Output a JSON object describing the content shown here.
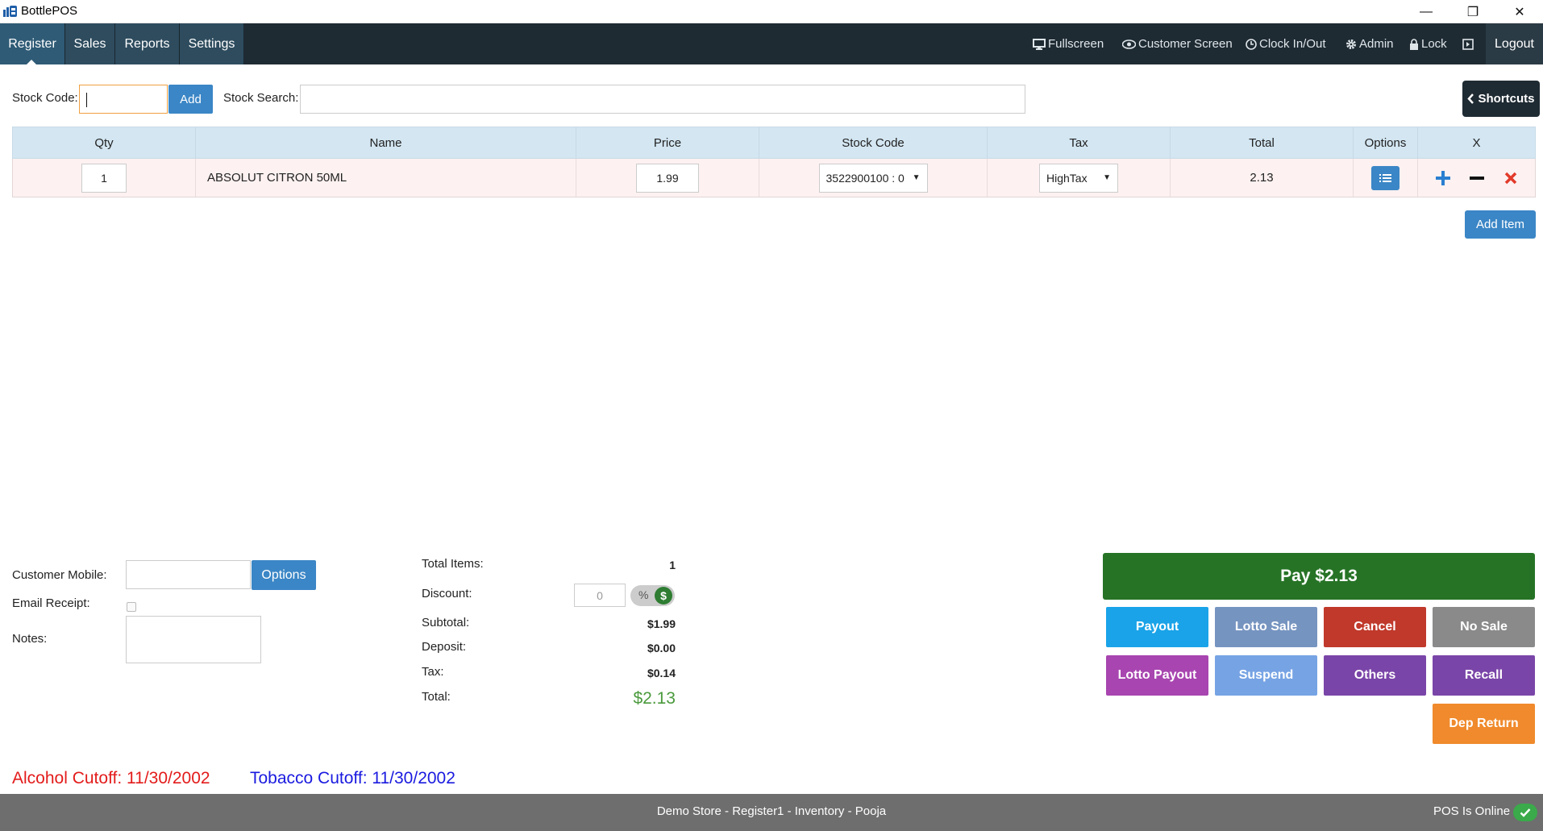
{
  "window": {
    "title": "BottlePOS",
    "minimize_label": "—",
    "restore_label": "❐",
    "close_label": "✕"
  },
  "nav": {
    "tabs": [
      {
        "label": "Register",
        "active": true
      },
      {
        "label": "Sales",
        "active": false
      },
      {
        "label": "Reports",
        "active": false
      },
      {
        "label": "Settings",
        "active": false
      }
    ],
    "right": {
      "fullscreen": "Fullscreen",
      "customer_screen": "Customer Screen",
      "clock": "Clock In/Out",
      "admin": "Admin",
      "lock": "Lock",
      "logout": "Logout"
    }
  },
  "stock": {
    "code_label": "Stock Code:",
    "code_value": "",
    "add_label": "Add",
    "search_label": "Stock Search:",
    "search_value": "",
    "shortcuts_label": "Shortcuts"
  },
  "table": {
    "headers": [
      "Qty",
      "Name",
      "Price",
      "Stock Code",
      "Tax",
      "Total",
      "Options",
      "X"
    ],
    "rows": [
      {
        "qty": "1",
        "name": "ABSOLUT CITRON 50ML",
        "price": "1.99",
        "stock_code": "3522900100 : 0",
        "tax": "HighTax",
        "total": "2.13"
      }
    ],
    "add_item_label": "Add Item"
  },
  "customer": {
    "mobile_label": "Customer Mobile:",
    "mobile_value": "",
    "options_label": "Options",
    "email_label": "Email Receipt:",
    "notes_label": "Notes:",
    "notes_value": ""
  },
  "totals": {
    "total_items_label": "Total Items:",
    "total_items": "1",
    "discount_label": "Discount:",
    "discount_value": "0",
    "discount_pct": "%",
    "discount_dollar": "$",
    "subtotal_label": "Subtotal:",
    "subtotal": "$1.99",
    "deposit_label": "Deposit:",
    "deposit": "$0.00",
    "tax_label": "Tax:",
    "tax": "$0.14",
    "total_label": "Total:",
    "total": "$2.13"
  },
  "actions": {
    "pay": "Pay $2.13",
    "payout": "Payout",
    "lotto_sale": "Lotto Sale",
    "cancel": "Cancel",
    "no_sale": "No Sale",
    "lotto_payout": "Lotto Payout",
    "suspend": "Suspend",
    "others": "Others",
    "recall": "Recall",
    "dep_return": "Dep Return"
  },
  "cutoffs": {
    "alcohol": "Alcohol Cutoff: 11/30/2002",
    "tobacco": "Tobacco Cutoff: 11/30/2002"
  },
  "footer": {
    "center": "Demo Store - Register1 - Inventory - Pooja",
    "status": "POS Is Online"
  },
  "colors": {
    "nav_bg": "#1f2b33",
    "accent_blue": "#3b86c6",
    "pay_green": "#267326",
    "alcohol_red": "#e31b1b",
    "tobacco_blue": "#1a1ae0",
    "total_green": "#4a9a3c"
  }
}
